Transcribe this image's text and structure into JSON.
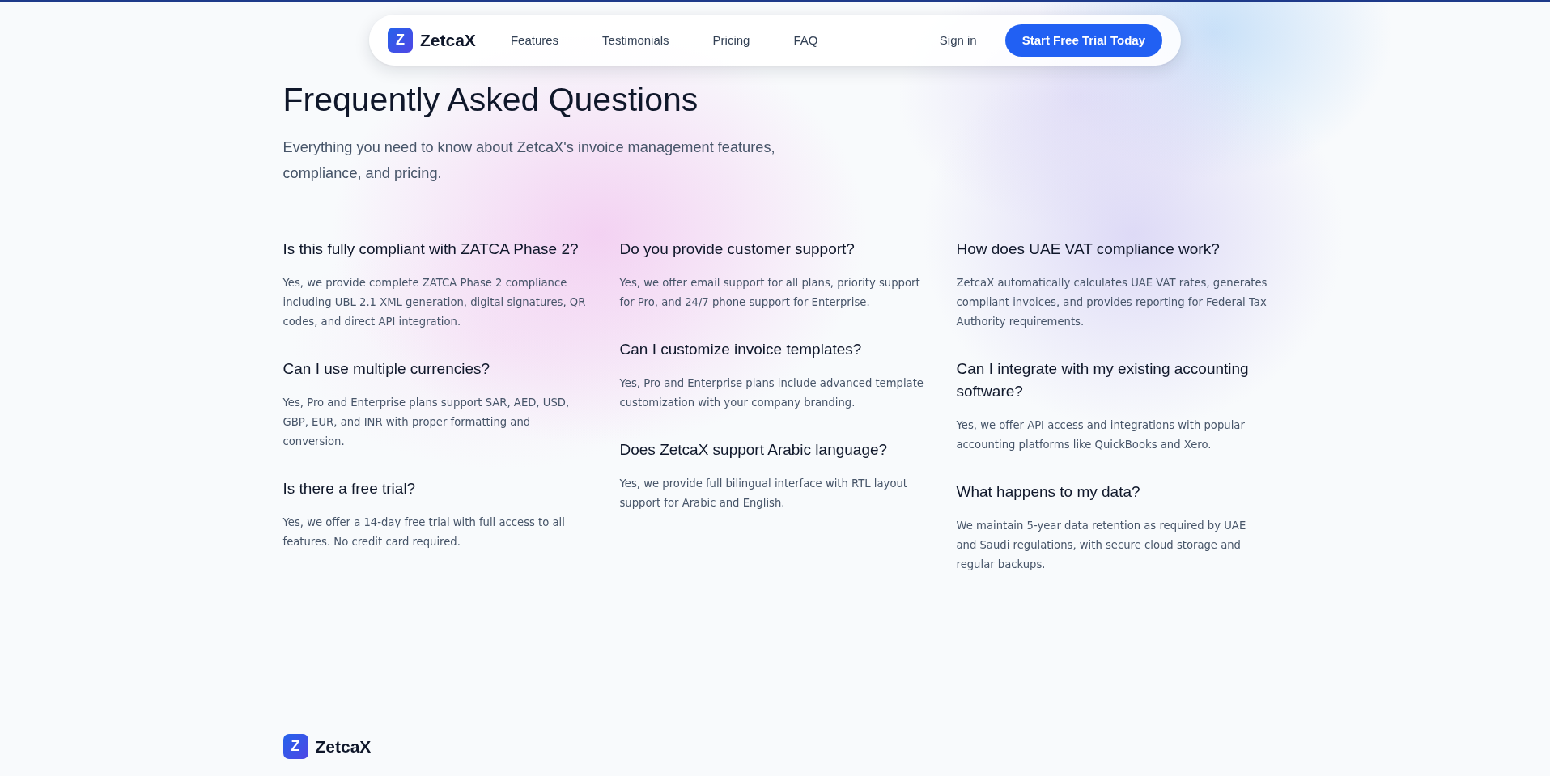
{
  "nav": {
    "brand": {
      "mark": "Z",
      "name": "ZetcaX"
    },
    "links": [
      "Features",
      "Testimonials",
      "Pricing",
      "FAQ"
    ],
    "sign_in": "Sign in",
    "cta": "Start Free Trial Today"
  },
  "faq": {
    "title": "Frequently Asked Questions",
    "subtitle": "Everything you need to know about ZetcaX's invoice management features, compliance, and pricing.",
    "columns": [
      {
        "items": [
          {
            "question": "Is this fully compliant with ZATCA Phase 2?",
            "answer": "Yes, we provide complete ZATCA Phase 2 compliance including UBL 2.1 XML generation, digital signatures, QR codes, and direct API integration."
          },
          {
            "question": "Can I use multiple currencies?",
            "answer": "Yes, Pro and Enterprise plans support SAR, AED, USD, GBP, EUR, and INR with proper formatting and conversion."
          },
          {
            "question": "Is there a free trial?",
            "answer": "Yes, we offer a 14-day free trial with full access to all features. No credit card required."
          }
        ]
      },
      {
        "items": [
          {
            "question": "Do you provide customer support?",
            "answer": "Yes, we offer email support for all plans, priority support for Pro, and 24/7 phone support for Enterprise."
          },
          {
            "question": "Can I customize invoice templates?",
            "answer": "Yes, Pro and Enterprise plans include advanced template customization with your company branding."
          },
          {
            "question": "Does ZetcaX support Arabic language?",
            "answer": "Yes, we provide full bilingual interface with RTL layout support for Arabic and English."
          }
        ]
      },
      {
        "items": [
          {
            "question": "How does UAE VAT compliance work?",
            "answer": "ZetcaX automatically calculates UAE VAT rates, generates compliant invoices, and provides reporting for Federal Tax Authority requirements."
          },
          {
            "question": "Can I integrate with my existing accounting software?",
            "answer": "Yes, we offer API access and integrations with popular accounting platforms like QuickBooks and Xero."
          },
          {
            "question": "What happens to my data?",
            "answer": "We maintain 5-year data retention as required by UAE and Saudi regulations, with secure cloud storage and regular backups."
          }
        ]
      }
    ]
  },
  "footer": {
    "brand": {
      "mark": "Z",
      "name": "ZetcaX"
    }
  }
}
